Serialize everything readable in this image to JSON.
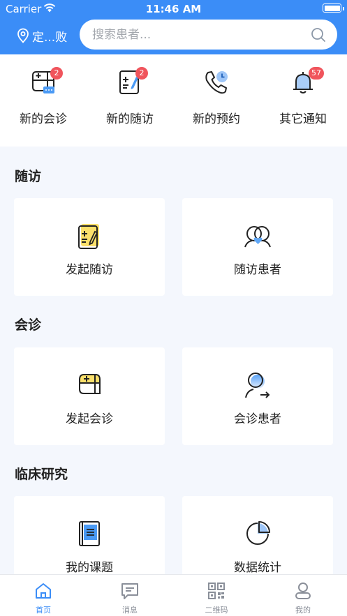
{
  "status_bar": {
    "carrier": "Carrier",
    "time": "11:46 AM"
  },
  "header": {
    "location": "定...败",
    "search_placeholder": "搜索患者..."
  },
  "quick_actions": [
    {
      "label": "新的会诊",
      "badge": "2",
      "icon": "consultation-icon"
    },
    {
      "label": "新的随访",
      "badge": "2",
      "icon": "followup-icon"
    },
    {
      "label": "新的预约",
      "badge": "",
      "icon": "phone-clock-icon"
    },
    {
      "label": "其它通知",
      "badge": "57",
      "icon": "bell-icon"
    }
  ],
  "sections": {
    "followup": {
      "title": "随访",
      "cards": [
        {
          "label": "发起随访",
          "icon": "start-followup-icon"
        },
        {
          "label": "随访患者",
          "icon": "followup-patients-icon"
        }
      ]
    },
    "consultation": {
      "title": "会诊",
      "cards": [
        {
          "label": "发起会诊",
          "icon": "start-consultation-icon"
        },
        {
          "label": "会诊患者",
          "icon": "consultation-patients-icon"
        }
      ]
    },
    "research": {
      "title": "临床研究",
      "cards": [
        {
          "label": "我的课题",
          "icon": "my-topics-icon"
        },
        {
          "label": "数据统计",
          "icon": "pie-chart-icon"
        }
      ]
    }
  },
  "tabbar": [
    {
      "label": "首页",
      "icon": "home-icon",
      "active": true
    },
    {
      "label": "消息",
      "icon": "message-icon",
      "active": false
    },
    {
      "label": "二维码",
      "icon": "qrcode-icon",
      "active": false
    },
    {
      "label": "我的",
      "icon": "profile-icon",
      "active": false
    }
  ],
  "colors": {
    "accent": "#3b8df7",
    "badge": "#f0545c",
    "highlight": "#fbe06b",
    "background": "#f4f7fd"
  }
}
